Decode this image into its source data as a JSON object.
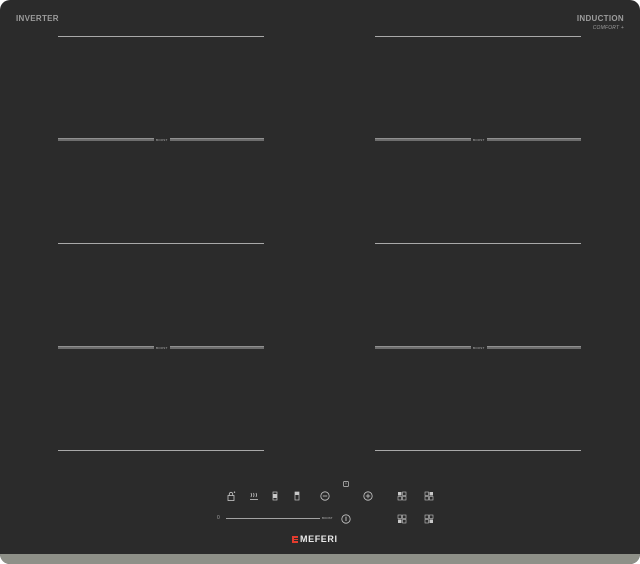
{
  "cooktop": {
    "brand_left": "INVERTER",
    "brand_right": "INDUCTION",
    "brand_right_sub": "COMFORT +",
    "zone_boost_label": "BOOST",
    "slider_min_label": "0",
    "slider_max_label": "BOOST",
    "logo_text": "MEFERI",
    "colors": {
      "glass": "#2b2b2b",
      "frame": "#8e9088",
      "logo_accent": "#e23c2e",
      "line": "#a9a9a9"
    },
    "controls": [
      {
        "name": "child-lock-icon",
        "label": "child lock"
      },
      {
        "name": "keep-warm-icon",
        "label": "keep warm"
      },
      {
        "name": "zone-left-icon",
        "label": "left zone"
      },
      {
        "name": "zone-right-icon",
        "label": "right zone"
      },
      {
        "name": "minus-icon",
        "label": "minus"
      },
      {
        "name": "timer-icon",
        "label": "timer"
      },
      {
        "name": "plus-icon",
        "label": "plus"
      },
      {
        "name": "zone-select-front-left-icon",
        "label": "front left"
      },
      {
        "name": "zone-select-rear-right-icon",
        "label": "rear right"
      },
      {
        "name": "zone-select-rear-left-icon",
        "label": "rear left"
      },
      {
        "name": "zone-select-front-right-icon",
        "label": "front right"
      },
      {
        "name": "power-icon",
        "label": "power"
      }
    ]
  }
}
